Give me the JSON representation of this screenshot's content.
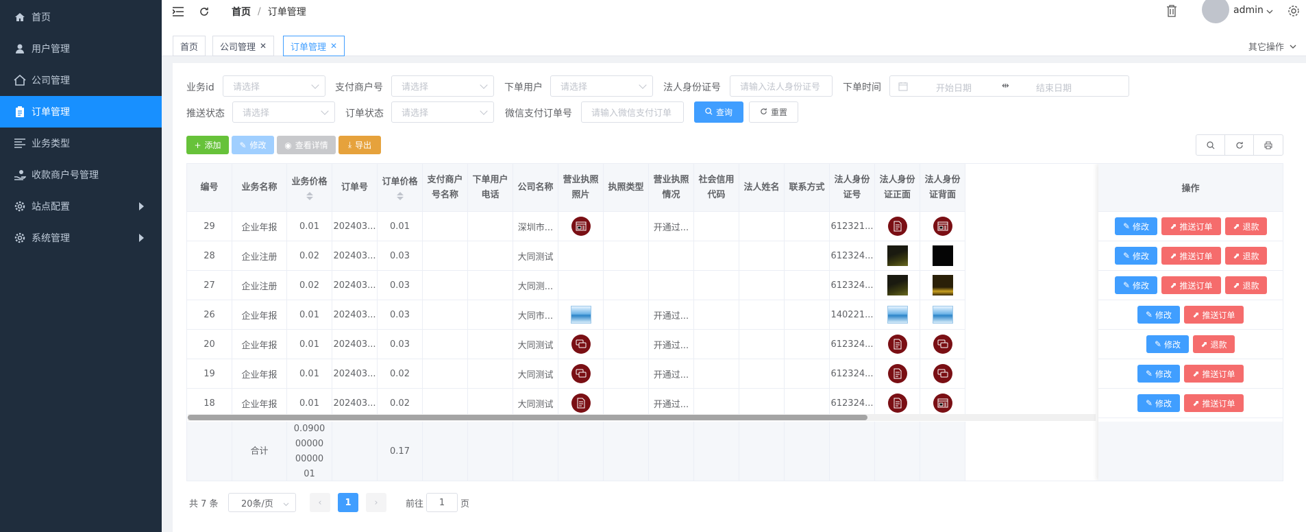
{
  "sidebar": {
    "items": [
      {
        "label": "首页",
        "icon": "home-icon"
      },
      {
        "label": "用户管理",
        "icon": "user-icon"
      },
      {
        "label": "公司管理",
        "icon": "house-icon"
      },
      {
        "label": "订单管理",
        "icon": "clipboard-icon",
        "active": true
      },
      {
        "label": "业务类型",
        "icon": "list-icon"
      },
      {
        "label": "收款商户号管理",
        "icon": "hand-coin-icon"
      },
      {
        "label": "站点配置",
        "icon": "gear-icon"
      },
      {
        "label": "系统管理",
        "icon": "gear-icon"
      }
    ]
  },
  "header": {
    "breadcrumb_home": "首页",
    "breadcrumb_current": "订单管理",
    "user": "admin"
  },
  "tags": [
    "首页",
    "公司管理",
    "订单管理"
  ],
  "other_ops": "其它操作",
  "form": {
    "business_id_label": "业务id",
    "business_id_placeholder": "请选择",
    "merchant_label": "支付商户号",
    "merchant_placeholder": "请选择",
    "order_user_label": "下单用户",
    "order_user_placeholder": "请选择",
    "id_card_label": "法人身份证号",
    "id_card_placeholder": "请输入法人身份证号",
    "order_time_label": "下单时间",
    "start_date": "开始日期",
    "end_date": "结束日期",
    "push_status_label": "推送状态",
    "push_status_placeholder": "请选择",
    "order_status_label": "订单状态",
    "order_status_placeholder": "请选择",
    "wechat_label": "微信支付订单号",
    "wechat_placeholder": "请输入微信支付订单",
    "query": "查询",
    "reset": "重置"
  },
  "toolbar": {
    "add": "添加",
    "edit": "修改",
    "view": "查看详情",
    "export": "导出"
  },
  "table": {
    "headers": [
      "编号",
      "业务名称",
      "业务价格",
      "订单号",
      "订单价格",
      "支付商户号名称",
      "下单用户电话",
      "公司名称",
      "营业执照照片",
      "执照类型",
      "营业执照情况",
      "社会信用代码",
      "法人姓名",
      "联系方式",
      "法人身份证号",
      "法人身份证正面",
      "法人身份证背面"
    ],
    "ops_header": "操作",
    "rows": [
      {
        "id": "29",
        "biz": "企业年报",
        "price": "0.01",
        "order_no": "202403...",
        "order_price": "0.01",
        "company": "深圳市...",
        "license_status": "开通过...",
        "id_no": "612321...",
        "lic_img": "circle-news",
        "front": "circle-doc",
        "back": "circle-news",
        "ops": [
          "edit",
          "push",
          "refund"
        ]
      },
      {
        "id": "28",
        "biz": "企业注册",
        "price": "0.02",
        "order_no": "202403...",
        "order_price": "0.03",
        "company": "大同测试",
        "license_status": "",
        "id_no": "612324...",
        "lic_img": "",
        "front": "dark",
        "back": "black",
        "ops": [
          "edit",
          "push",
          "refund"
        ]
      },
      {
        "id": "27",
        "biz": "企业注册",
        "price": "0.02",
        "order_no": "202403...",
        "order_price": "0.03",
        "company": "大同测...",
        "license_status": "",
        "id_no": "612324...",
        "lic_img": "",
        "front": "dark",
        "back": "dark2",
        "ops": [
          "edit",
          "push",
          "refund"
        ]
      },
      {
        "id": "26",
        "biz": "企业年报",
        "price": "0.01",
        "order_no": "202403...",
        "order_price": "0.03",
        "company": "大同市...",
        "license_status": "开通过...",
        "id_no": "140221...",
        "lic_img": "photo",
        "front": "photo",
        "back": "photo",
        "ops": [
          "edit",
          "push"
        ]
      },
      {
        "id": "20",
        "biz": "企业年报",
        "price": "0.01",
        "order_no": "202403...",
        "order_price": "0.03",
        "company": "大同测试",
        "license_status": "开通过...",
        "id_no": "612324...",
        "lic_img": "circle-chat",
        "front": "circle-doc",
        "back": "circle-chat",
        "ops": [
          "edit",
          "refund"
        ]
      },
      {
        "id": "19",
        "biz": "企业年报",
        "price": "0.01",
        "order_no": "202403...",
        "order_price": "0.02",
        "company": "大同测试",
        "license_status": "开通过...",
        "id_no": "612324...",
        "lic_img": "circle-chat",
        "front": "circle-doc",
        "back": "circle-chat",
        "ops": [
          "edit",
          "push"
        ]
      },
      {
        "id": "18",
        "biz": "企业年报",
        "price": "0.01",
        "order_no": "202403...",
        "order_price": "0.02",
        "company": "大同测试",
        "license_status": "开通过...",
        "id_no": "612324...",
        "lic_img": "circle-doc",
        "front": "circle-doc",
        "back": "circle-news",
        "ops": [
          "edit",
          "push"
        ]
      }
    ],
    "op_labels": {
      "edit": "修改",
      "push": "推送订单",
      "refund": "退款"
    },
    "sum_label": "合计",
    "sum_price": "0.0900000000000001",
    "sum_order_price": "0.17"
  },
  "pagination": {
    "total": "共 7 条",
    "page_size": "20条/页",
    "current": "1",
    "goto_label": "前往",
    "goto_value": "1",
    "page_unit": "页"
  },
  "colors": {
    "sidebar_bg": "#1f2d3d",
    "active": "#1890ff",
    "primary": "#409eff",
    "danger": "#f56c6c",
    "success": "#67c23a",
    "warning": "#e6a23c"
  }
}
